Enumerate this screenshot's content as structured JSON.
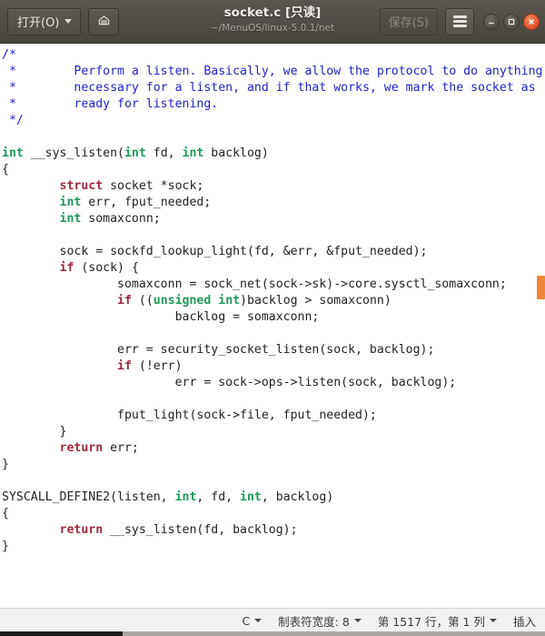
{
  "window": {
    "title": "socket.c [只读]",
    "subtitle": "~/MenuOS/linux-5.0.1/net",
    "open_label": "打开(O)",
    "save_label": "保存(S)",
    "icons": {
      "open_caret": "chevron-down-icon",
      "save_as": "save-as-icon",
      "hamburger": "hamburger-menu-icon",
      "minimize": "minimize-icon",
      "maximize": "maximize-icon",
      "close": "close-icon"
    },
    "colors": {
      "titlebar_bg": "#504c46",
      "close_button": "#e2502b",
      "scroll_thumb": "#f08437"
    }
  },
  "editor": {
    "language_syntax": "C",
    "colors": {
      "comment": "#2222cc",
      "keyword": "#a0293e",
      "type": "#1d9a5a",
      "text": "#222222",
      "background": "#ffffff"
    },
    "code_lines": [
      {
        "type": "comment",
        "text": "/*"
      },
      {
        "type": "comment",
        "text": " *\tPerform a listen. Basically, we allow the protocol to do anything"
      },
      {
        "type": "comment",
        "text": " *\tnecessary for a listen, and if that works, we mark the socket as"
      },
      {
        "type": "comment",
        "text": " *\tready for listening."
      },
      {
        "type": "comment",
        "text": " */"
      },
      {
        "type": "blank",
        "text": ""
      },
      {
        "type": "code",
        "text": "int __sys_listen(int fd, int backlog)"
      },
      {
        "type": "code",
        "text": "{"
      },
      {
        "type": "code",
        "text": "\tstruct socket *sock;"
      },
      {
        "type": "code",
        "text": "\tint err, fput_needed;"
      },
      {
        "type": "code",
        "text": "\tint somaxconn;"
      },
      {
        "type": "blank",
        "text": ""
      },
      {
        "type": "code",
        "text": "\tsock = sockfd_lookup_light(fd, &err, &fput_needed);"
      },
      {
        "type": "code",
        "text": "\tif (sock) {"
      },
      {
        "type": "code",
        "text": "\t\tsomaxconn = sock_net(sock->sk)->core.sysctl_somaxconn;"
      },
      {
        "type": "code",
        "text": "\t\tif ((unsigned int)backlog > somaxconn)"
      },
      {
        "type": "code",
        "text": "\t\t\tbacklog = somaxconn;"
      },
      {
        "type": "blank",
        "text": ""
      },
      {
        "type": "code",
        "text": "\t\terr = security_socket_listen(sock, backlog);"
      },
      {
        "type": "code",
        "text": "\t\tif (!err)"
      },
      {
        "type": "code",
        "text": "\t\t\terr = sock->ops->listen(sock, backlog);"
      },
      {
        "type": "blank",
        "text": ""
      },
      {
        "type": "code",
        "text": "\t\tfput_light(sock->file, fput_needed);"
      },
      {
        "type": "code",
        "text": "\t}"
      },
      {
        "type": "code",
        "text": "\treturn err;"
      },
      {
        "type": "code",
        "text": "}"
      },
      {
        "type": "blank",
        "text": ""
      },
      {
        "type": "code",
        "text": "SYSCALL_DEFINE2(listen, int, fd, int, backlog)"
      },
      {
        "type": "code",
        "text": "{"
      },
      {
        "type": "code",
        "text": "\treturn __sys_listen(fd, backlog);"
      },
      {
        "type": "code",
        "text": "}"
      }
    ]
  },
  "statusbar": {
    "language": "C",
    "tab_width": "制表符宽度: 8",
    "cursor_position": "第 1517 行，第 1 列",
    "insert_mode": "插入"
  }
}
